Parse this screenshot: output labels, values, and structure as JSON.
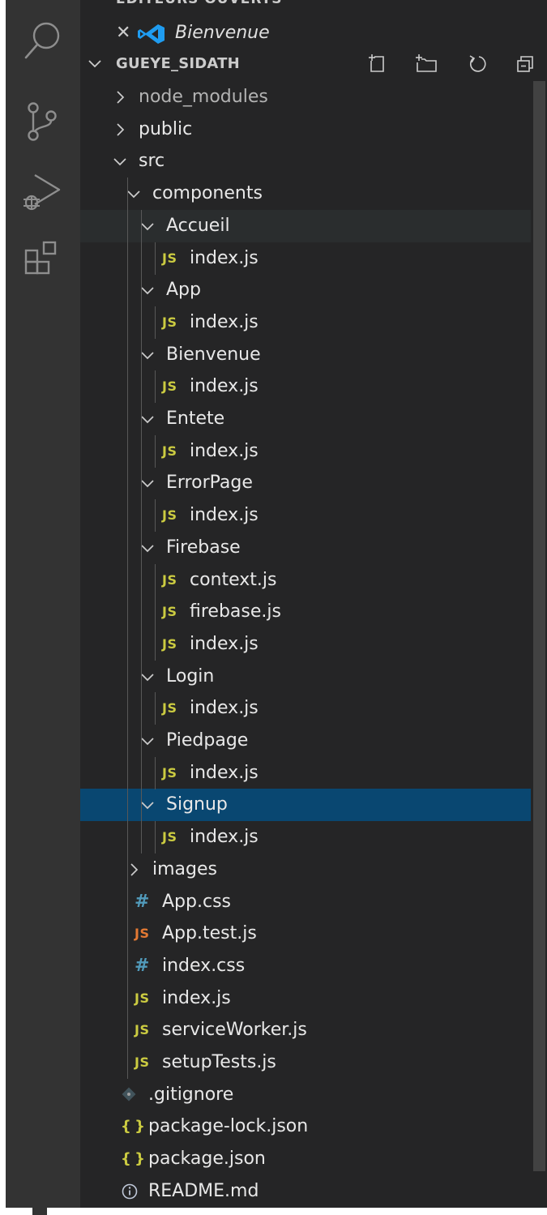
{
  "sidebar": {
    "open_editors_label": "EDITEURS OUVERTS",
    "open_editors": [
      {
        "label": "Bienvenue",
        "icon": "vscode-logo-icon"
      }
    ],
    "project": {
      "label": "GUEYE_SIDATH",
      "actions": [
        "new-file-icon",
        "new-folder-icon",
        "refresh-icon",
        "collapse-all-icon"
      ]
    },
    "tree": [
      {
        "label": "node_modules",
        "kind": "folder",
        "expanded": false,
        "depth": 0
      },
      {
        "label": "public",
        "kind": "folder",
        "expanded": false,
        "depth": 0
      },
      {
        "label": "src",
        "kind": "folder",
        "expanded": true,
        "depth": 0
      },
      {
        "label": "components",
        "kind": "folder",
        "expanded": true,
        "depth": 1
      },
      {
        "label": "Accueil",
        "kind": "folder",
        "expanded": true,
        "depth": 2
      },
      {
        "label": "index.js",
        "kind": "js",
        "depth": 3
      },
      {
        "label": "App",
        "kind": "folder",
        "expanded": true,
        "depth": 2
      },
      {
        "label": "index.js",
        "kind": "js",
        "depth": 3
      },
      {
        "label": "Bienvenue",
        "kind": "folder",
        "expanded": true,
        "depth": 2
      },
      {
        "label": "index.js",
        "kind": "js",
        "depth": 3
      },
      {
        "label": "Entete",
        "kind": "folder",
        "expanded": true,
        "depth": 2
      },
      {
        "label": "index.js",
        "kind": "js",
        "depth": 3
      },
      {
        "label": "ErrorPage",
        "kind": "folder",
        "expanded": true,
        "depth": 2
      },
      {
        "label": "index.js",
        "kind": "js",
        "depth": 3
      },
      {
        "label": "Firebase",
        "kind": "folder",
        "expanded": true,
        "depth": 2
      },
      {
        "label": "context.js",
        "kind": "js",
        "depth": 3
      },
      {
        "label": "firebase.js",
        "kind": "js",
        "depth": 3
      },
      {
        "label": "index.js",
        "kind": "js",
        "depth": 3
      },
      {
        "label": "Login",
        "kind": "folder",
        "expanded": true,
        "depth": 2
      },
      {
        "label": "index.js",
        "kind": "js",
        "depth": 3
      },
      {
        "label": "Piedpage",
        "kind": "folder",
        "expanded": true,
        "depth": 2
      },
      {
        "label": "index.js",
        "kind": "js",
        "depth": 3
      },
      {
        "label": "Signup",
        "kind": "folder",
        "expanded": true,
        "depth": 2,
        "selected": true
      },
      {
        "label": "index.js",
        "kind": "js",
        "depth": 3
      },
      {
        "label": "images",
        "kind": "folder",
        "expanded": false,
        "depth": 1
      },
      {
        "label": "App.css",
        "kind": "css",
        "depth": 1
      },
      {
        "label": "App.test.js",
        "kind": "test",
        "depth": 1
      },
      {
        "label": "index.css",
        "kind": "css",
        "depth": 1
      },
      {
        "label": "index.js",
        "kind": "js",
        "depth": 1
      },
      {
        "label": "serviceWorker.js",
        "kind": "js",
        "depth": 1
      },
      {
        "label": "setupTests.js",
        "kind": "js",
        "depth": 1
      },
      {
        "label": ".gitignore",
        "kind": "git",
        "depth": 0
      },
      {
        "label": "package-lock.json",
        "kind": "json",
        "depth": 0
      },
      {
        "label": "package.json",
        "kind": "json",
        "depth": 0
      },
      {
        "label": "README.md",
        "kind": "info",
        "depth": 0
      }
    ]
  },
  "activity_bar": [
    "search-icon",
    "source-control-icon",
    "run-debug-icon",
    "extensions-icon"
  ],
  "colors": {
    "activity_bar": "#333333",
    "sidebar": "#252526",
    "selection": "#094771",
    "js_icon": "#cbcb41",
    "test_icon": "#e37933",
    "css_icon": "#519aba"
  }
}
